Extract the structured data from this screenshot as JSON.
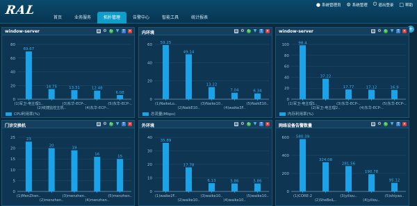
{
  "app": {
    "logo": "RAL",
    "nav": [
      "首页",
      "业务服务",
      "拓扑管理",
      "告警中心",
      "智能工具",
      "统计报表"
    ],
    "nav_active_index": 2,
    "top_actions": [
      {
        "icon": "user-icon",
        "label": "系统管理员"
      },
      {
        "icon": "gear-icon",
        "label": "系统管理"
      },
      {
        "icon": "logout-icon",
        "label": "退出登录"
      },
      {
        "icon": "help-icon",
        "label": "帮助"
      }
    ],
    "add_button_label": "+"
  },
  "colors": {
    "bar": "#1aa3e8",
    "label": "#3ab4f2",
    "axis": "#9fc2da",
    "grid": "#24506e"
  },
  "panels": [
    {
      "title": "window-server",
      "chart_data": {
        "type": "bar",
        "categories": [
          "(1)军卫-电主..",
          "(2)岐捷监控主机..",
          "(3)东华-ECP-..",
          "(4)东华-ECP-..",
          "(5)东华-ECP-.."
        ],
        "x_tick_rows": [
          [
            "(1)军卫-电主理1..",
            "",
            "(3)东华-ECP-..",
            "",
            "(5)东华-ECP-.."
          ],
          [
            "",
            "(2)岐捷监控主机..",
            "",
            "(4)东华-ECP-..",
            ""
          ]
        ],
        "values": [
          69.67,
          14.75,
          13.31,
          12.48,
          6.08
        ],
        "value_labels": [
          "69.67",
          "14.75",
          "13.31",
          "12.48",
          "6.08"
        ],
        "yticks": [
          0,
          20,
          40,
          60,
          80
        ],
        "ylim": [
          0,
          80
        ],
        "legend": "CPU利用率(%)"
      }
    },
    {
      "title": "内环境",
      "chart_data": {
        "type": "bar",
        "categories": [
          "(1)NaikeLo..",
          "(2)NaikE10..",
          "(3)Naike10..",
          "(4)waike3F..",
          "(5)NaikE10.."
        ],
        "x_tick_rows": [
          [
            "(1)NaikeLo..",
            "",
            "(3)Naike10..",
            "",
            "(5)NaikE10.."
          ],
          [
            "",
            "(2)NaikE10..",
            "",
            "(4)waike3F..",
            ""
          ]
        ],
        "values": [
          59.25,
          49.14,
          13.22,
          7.04,
          6.34
        ],
        "value_labels": [
          "59.25",
          "49.14",
          "13.22",
          "7.04",
          "6.34"
        ],
        "yticks": [
          0,
          20,
          40,
          60
        ],
        "ylim": [
          0,
          60
        ],
        "legend": "总流量(Mbps)"
      }
    },
    {
      "title": "window-server",
      "chart_data": {
        "type": "bar",
        "categories": [
          "(1)军卫-电主..",
          "(2)军卫-电主理2..",
          "(3)东华-ECP-..",
          "(4)东华-ECP-..",
          "(5)东华-ECP-.."
        ],
        "x_tick_rows": [
          [
            "(1)军卫-电主理1..",
            "",
            "(3)东华-ECP-..",
            "",
            "(5)东华-ECP-.."
          ],
          [
            "",
            "(2)军卫-电主理2..",
            "",
            "(4)东华-ECP-..",
            ""
          ]
        ],
        "values": [
          98.4,
          37.22,
          17.77,
          17.12,
          16.9
        ],
        "value_labels": [
          "98.4",
          "37.22",
          "17.77",
          "17.12",
          "16.9"
        ],
        "yticks": [
          0,
          20,
          40,
          60,
          80,
          100
        ],
        "ylim": [
          0,
          100
        ],
        "legend": "内存利用率(%)"
      }
    },
    {
      "title": "门诊交换机",
      "chart_data": {
        "type": "bar",
        "categories": [
          "(1)MenZhen..",
          "(2)menzhen..",
          "(3)menzhen..",
          "(4)menzhen..",
          "(5)menzhen.."
        ],
        "x_tick_rows": [
          [
            "(1)MenZhen..",
            "",
            "(3)menzhen..",
            "",
            "(5)menzhen.."
          ],
          [
            "",
            "(2)menzhen..",
            "",
            "(4)menzhen..",
            ""
          ]
        ],
        "values": [
          23,
          20,
          19,
          16,
          15
        ],
        "value_labels": [
          "23",
          "20",
          "19",
          "16",
          "15"
        ],
        "yticks": [
          0,
          5,
          10,
          15,
          20,
          25
        ],
        "ylim": [
          0,
          25
        ],
        "legend": ""
      }
    },
    {
      "title": "外环境",
      "chart_data": {
        "type": "bar",
        "categories": [
          "(1)waike2F..",
          "(2)waike10..",
          "(3)waike10..",
          "(4)waike10..",
          "(5)waike10.."
        ],
        "x_tick_rows": [
          [
            "(1)waike2F..",
            "",
            "(3)waike10..",
            "",
            "(5)waike10.."
          ],
          [
            "",
            "(2)waike10..",
            "",
            "(4)waike10..",
            ""
          ]
        ],
        "values": [
          35.89,
          17.78,
          6.13,
          5.86,
          5.86
        ],
        "value_labels": [
          "35.89",
          "17.78",
          "6.13",
          "5.86",
          "5.86"
        ],
        "yticks": [
          0,
          10,
          20,
          30,
          40
        ],
        "ylim": [
          0,
          40
        ],
        "legend": ""
      }
    },
    {
      "title": "网络设备告警数量",
      "chart_data": {
        "type": "bar",
        "categories": [
          "(1)CORE-2",
          "(2)SheBeiL..",
          "(3)yiliou..",
          "(4)yiliou..",
          "(5)shiyao.."
        ],
        "x_tick_rows": [
          [
            "(1)CORE-2",
            "",
            "(3)yiliou..",
            "",
            "(5)shiyao.."
          ],
          [
            "",
            "(2)SheBeiL..",
            "",
            "(4)yiliou..",
            ""
          ]
        ],
        "values": [
          580.39,
          324.08,
          281.56,
          190.78,
          95.12
        ],
        "value_labels": [
          "580.39",
          "324.08",
          "281.56",
          "190.78",
          "95.12"
        ],
        "yticks": [
          0,
          200,
          400,
          600
        ],
        "ylim": [
          0,
          600
        ],
        "legend": ""
      }
    }
  ]
}
